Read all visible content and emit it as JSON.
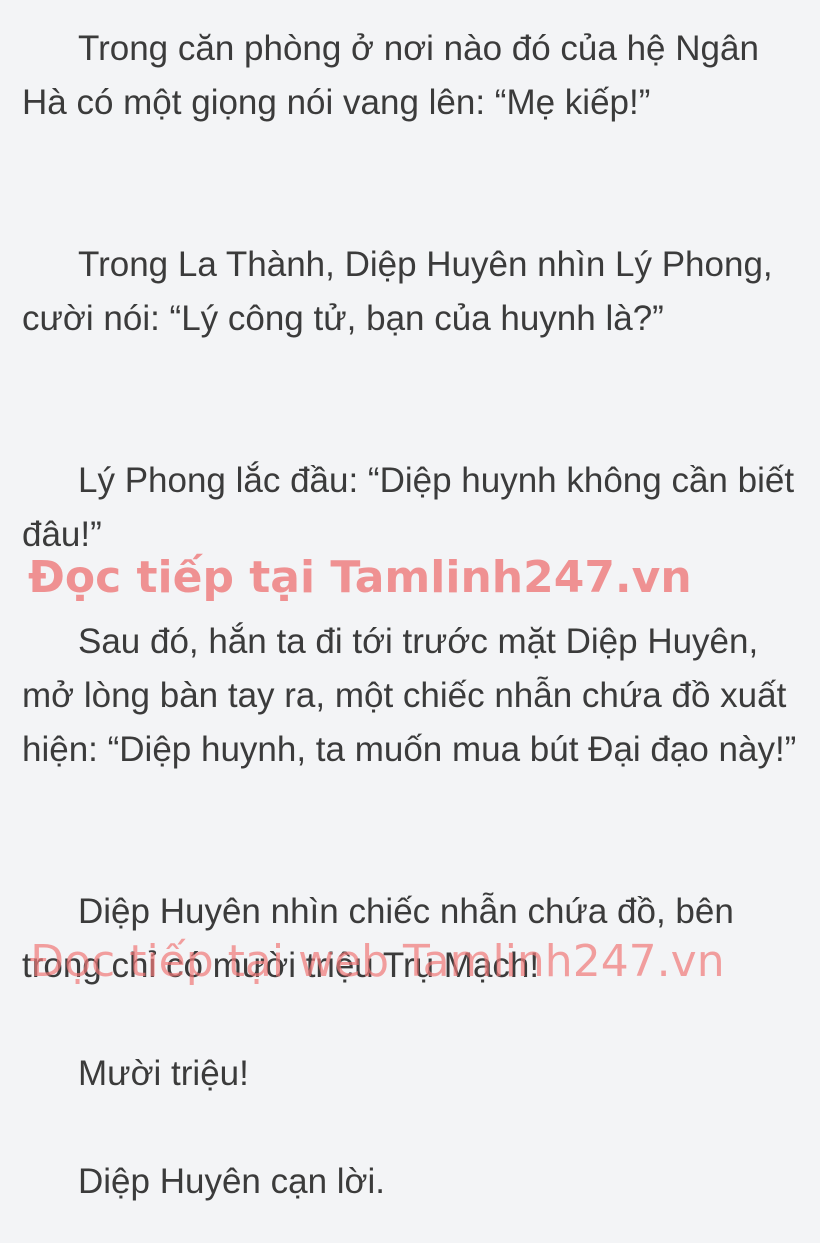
{
  "paragraphs": [
    "Trong căn phòng ở nơi nào đó của hệ Ngân Hà có một giọng nói vang lên: “Mẹ kiếp!”",
    "Trong La Thành, Diệp Huyên nhìn Lý Phong, cười nói: “Lý công tử, bạn của huynh là?”",
    "Lý Phong lắc đầu: “Diệp huynh không cần biết đâu!”",
    "Sau đó, hắn ta đi tới trước mặt Diệp Huyên, mở lòng bàn tay ra, một chiếc nhẫn chứa đồ xuất hiện: “Diệp huynh, ta muốn mua bút Đại đạo này!”",
    "Diệp Huyên nhìn chiếc nhẫn chứa đồ, bên trong chỉ có mười triệu Trụ Mạch!",
    "Mười triệu!",
    "Diệp Huyên cạn lời."
  ],
  "watermarks": [
    "Đọc tiếp tại Tamlinh247.vn",
    "Đọc tiếp tại web Tamlinh247.vn"
  ],
  "colors": {
    "background": "#f3f4f6",
    "text": "#3b3b3b",
    "watermark": "#ee7070"
  }
}
